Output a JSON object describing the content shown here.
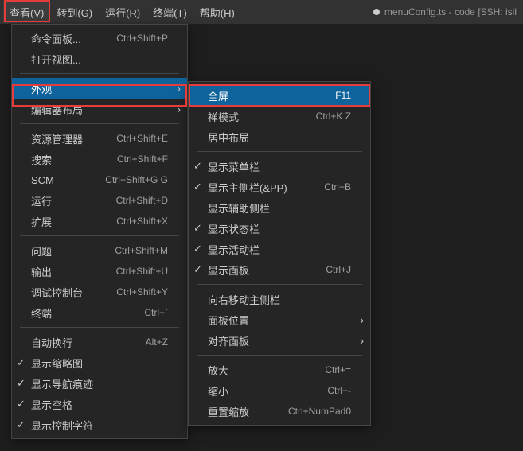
{
  "menubar": {
    "items": [
      {
        "label": "查看(V)"
      },
      {
        "label": "转到(G)"
      },
      {
        "label": "运行(R)"
      },
      {
        "label": "终端(T)"
      },
      {
        "label": "帮助(H)"
      }
    ]
  },
  "title": "menuConfig.ts - code [SSH: isil",
  "viewMenu": {
    "groups": [
      [
        {
          "label": "命令面板...",
          "shortcut": "Ctrl+Shift+P"
        },
        {
          "label": "打开视图..."
        }
      ],
      [
        {
          "label": "外观",
          "submenu": true,
          "highlighted": true
        },
        {
          "label": "编辑器布局",
          "submenu": true
        }
      ],
      [
        {
          "label": "资源管理器",
          "shortcut": "Ctrl+Shift+E"
        },
        {
          "label": "搜索",
          "shortcut": "Ctrl+Shift+F"
        },
        {
          "label": "SCM",
          "shortcut": "Ctrl+Shift+G G"
        },
        {
          "label": "运行",
          "shortcut": "Ctrl+Shift+D"
        },
        {
          "label": "扩展",
          "shortcut": "Ctrl+Shift+X"
        }
      ],
      [
        {
          "label": "问题",
          "shortcut": "Ctrl+Shift+M"
        },
        {
          "label": "输出",
          "shortcut": "Ctrl+Shift+U"
        },
        {
          "label": "调试控制台",
          "shortcut": "Ctrl+Shift+Y"
        },
        {
          "label": "终端",
          "shortcut": "Ctrl+`"
        }
      ],
      [
        {
          "label": "自动换行",
          "shortcut": "Alt+Z"
        },
        {
          "label": "显示缩略图",
          "checked": true
        },
        {
          "label": "显示导航痕迹",
          "checked": true
        },
        {
          "label": "显示空格",
          "checked": true
        },
        {
          "label": "显示控制字符",
          "checked": true
        }
      ]
    ]
  },
  "appearanceMenu": {
    "groups": [
      [
        {
          "label": "全屏",
          "shortcut": "F11",
          "highlighted": true
        },
        {
          "label": "禅模式",
          "shortcut": "Ctrl+K Z"
        },
        {
          "label": "居中布局"
        }
      ],
      [
        {
          "label": "显示菜单栏",
          "checked": true
        },
        {
          "label": "显示主侧栏(&PP)",
          "shortcut": "Ctrl+B",
          "checked": true
        },
        {
          "label": "显示辅助侧栏"
        },
        {
          "label": "显示状态栏",
          "checked": true
        },
        {
          "label": "显示活动栏",
          "checked": true
        },
        {
          "label": "显示面板",
          "shortcut": "Ctrl+J",
          "checked": true
        }
      ],
      [
        {
          "label": "向右移动主侧栏"
        },
        {
          "label": "面板位置",
          "submenu": true
        },
        {
          "label": "对齐面板",
          "submenu": true
        }
      ],
      [
        {
          "label": "放大",
          "shortcut": "Ctrl+="
        },
        {
          "label": "缩小",
          "shortcut": "Ctrl+-"
        },
        {
          "label": "重置缩放",
          "shortcut": "Ctrl+NumPad0"
        }
      ]
    ]
  }
}
